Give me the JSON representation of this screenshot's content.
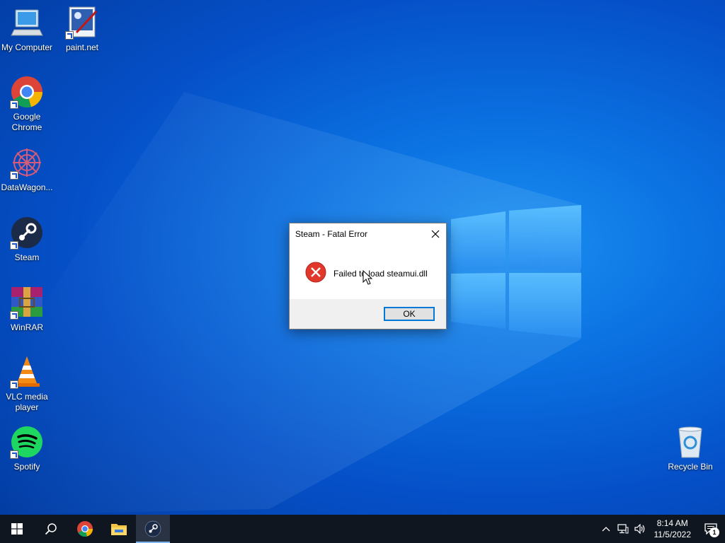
{
  "desktop": {
    "icons": [
      {
        "label": "My Computer"
      },
      {
        "label": "paint.net"
      },
      {
        "label": "Google Chrome"
      },
      {
        "label": "DataWagon..."
      },
      {
        "label": "Steam"
      },
      {
        "label": "WinRAR"
      },
      {
        "label": "VLC media player"
      },
      {
        "label": "Spotify"
      },
      {
        "label": "Recycle Bin"
      }
    ]
  },
  "dialog": {
    "title": "Steam - Fatal Error",
    "message": "Failed to load steamui.dll",
    "ok_label": "OK"
  },
  "taskbar": {
    "clock_time": "8:14 AM",
    "clock_date": "11/5/2022",
    "notification_count": "1"
  },
  "colors": {
    "accent": "#0078d7",
    "error": "#e0382b",
    "taskbar": "#101620"
  }
}
